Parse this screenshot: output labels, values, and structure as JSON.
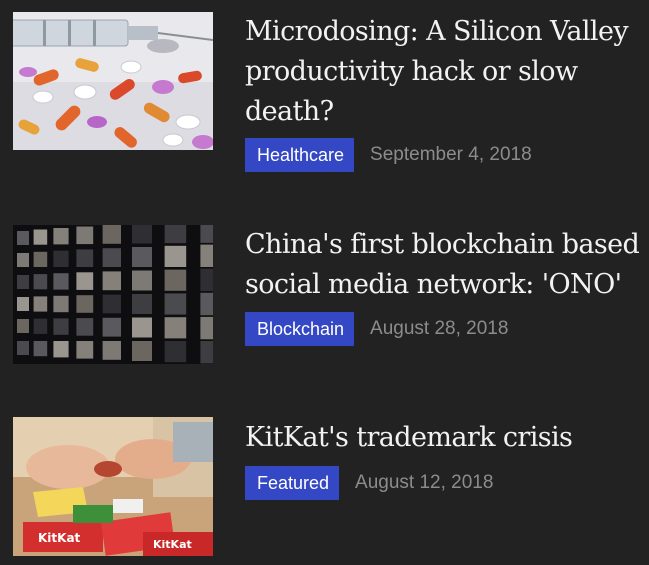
{
  "articles": [
    {
      "title": "Microdosing: A Silicon Valley productivity hack or slow death?",
      "category": "Healthcare",
      "date": "September 4, 2018",
      "image": "pills-and-syringe"
    },
    {
      "title": "China's first blockchain based social media network: 'ONO'",
      "category": "Blockchain",
      "date": "August 28, 2018",
      "image": "wall-of-screens"
    },
    {
      "title": "KitKat's trademark crisis",
      "category": "Featured",
      "date": "August 12, 2018",
      "image": "kitkat-hands"
    }
  ],
  "colors": {
    "background": "#222222",
    "badge": "#3448c5",
    "title": "#f2f2f2",
    "date": "#8c8c8c"
  }
}
